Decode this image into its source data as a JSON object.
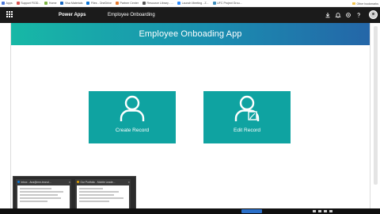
{
  "bookmarks": {
    "items": [
      {
        "label": "Apps",
        "color": "#4a76d8"
      },
      {
        "label": "Support FIOD...",
        "color": "#d9534f"
      },
      {
        "label": "Home",
        "color": "#7cb342"
      },
      {
        "label": "Visa Materials",
        "color": "#1565c0"
      },
      {
        "label": "Files - OneDrive",
        "color": "#0a74d6"
      },
      {
        "label": "Partner Center",
        "color": "#e57a2e"
      },
      {
        "label": "Resource Library - ...",
        "color": "#555555"
      },
      {
        "label": "Launch Meeting - Z...",
        "color": "#2d8cff"
      },
      {
        "label": "UFC Project Grou...",
        "color": "#3c8dbc"
      }
    ],
    "other": "Other bookmarks"
  },
  "header": {
    "brand": "Power Apps",
    "app_name": "Employee Onboarding"
  },
  "app": {
    "title": "Employee Onboading App",
    "tiles": {
      "create": "Create Record",
      "edit": "Edit Record"
    }
  },
  "thumbnails": [
    {
      "title": "Inbox - Ana@mm-tecnol...",
      "accent": "#0a74d6"
    },
    {
      "title": "Our Portfolio - Mobile Leade...",
      "accent": "#e0a100"
    }
  ],
  "colors": {
    "header_bg": "#1b1b1b",
    "tile": "#0fa3a1",
    "title_gradient_start": "#17b8a6",
    "title_gradient_end": "#2466a8"
  }
}
